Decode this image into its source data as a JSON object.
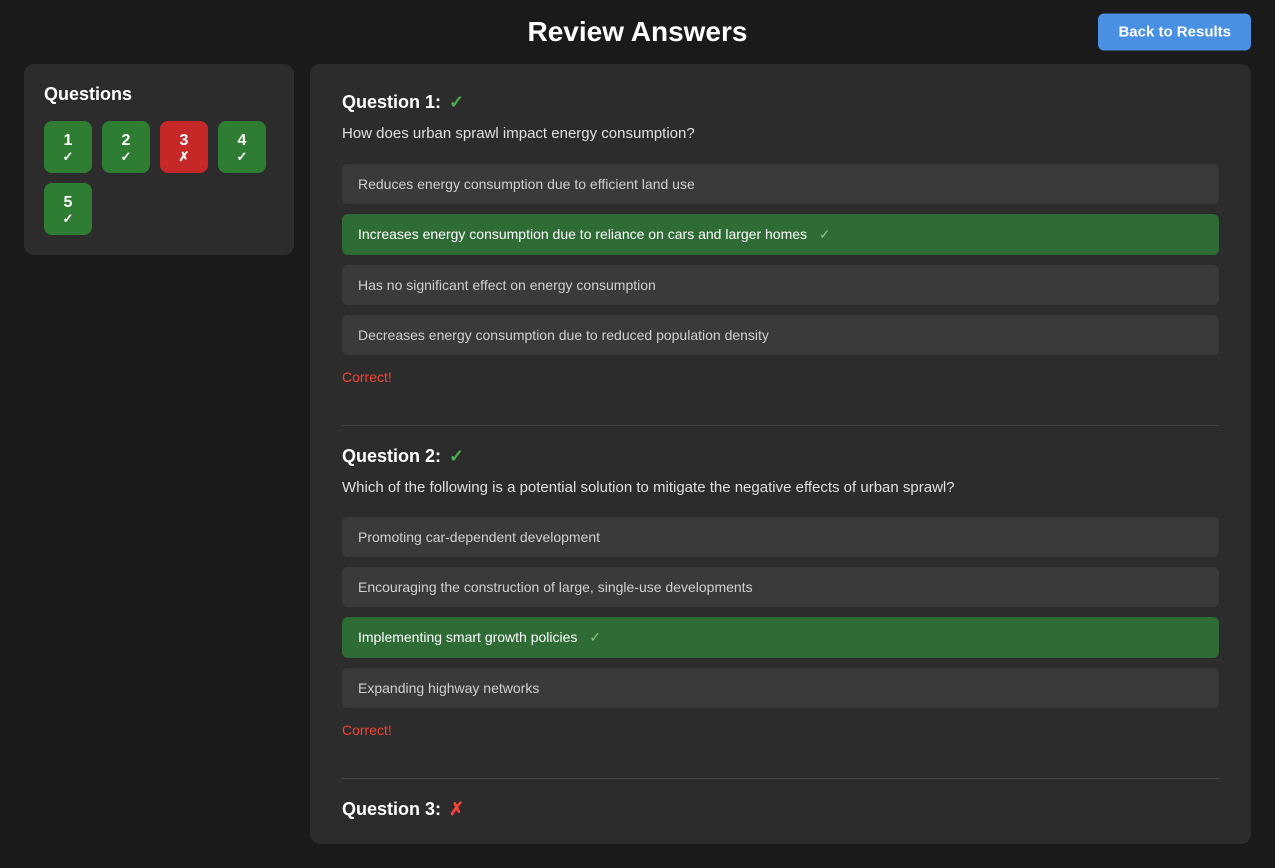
{
  "header": {
    "title": "Review Answers",
    "back_button_label": "Back to Results"
  },
  "sidebar": {
    "title": "Questions",
    "badges": [
      {
        "number": "1",
        "status": "correct",
        "icon": "✓"
      },
      {
        "number": "2",
        "status": "correct",
        "icon": "✓"
      },
      {
        "number": "3",
        "status": "incorrect",
        "icon": "✗"
      },
      {
        "number": "4",
        "status": "correct",
        "icon": "✓"
      },
      {
        "number": "5",
        "status": "correct",
        "icon": "✓"
      }
    ]
  },
  "questions": [
    {
      "id": "q1",
      "label": "Question 1:",
      "status": "correct",
      "status_icon": "✓",
      "text": "How does urban sprawl impact energy consumption?",
      "options": [
        {
          "text": "Reduces energy consumption due to efficient land use",
          "state": "normal"
        },
        {
          "text": "Increases energy consumption due to reliance on cars and larger homes",
          "state": "selected-correct",
          "suffix": "✓"
        },
        {
          "text": "Has no significant effect on energy consumption",
          "state": "normal"
        },
        {
          "text": "Decreases energy consumption due to reduced population density",
          "state": "normal"
        }
      ],
      "result": "Correct!"
    },
    {
      "id": "q2",
      "label": "Question 2:",
      "status": "correct",
      "status_icon": "✓",
      "text": "Which of the following is a potential solution to mitigate the negative effects of urban sprawl?",
      "options": [
        {
          "text": "Promoting car-dependent development",
          "state": "normal"
        },
        {
          "text": "Encouraging the construction of large, single-use developments",
          "state": "normal"
        },
        {
          "text": "Implementing smart growth policies",
          "state": "selected-correct",
          "suffix": "✓"
        },
        {
          "text": "Expanding highway networks",
          "state": "normal"
        }
      ],
      "result": "Correct!"
    },
    {
      "id": "q3",
      "label": "Question 3:",
      "status": "incorrect",
      "status_icon": "✗",
      "text": "",
      "options": [],
      "result": ""
    }
  ],
  "colors": {
    "correct_green": "#4caf50",
    "incorrect_red": "#f44336",
    "selected_correct_bg": "#2e6b35",
    "badge_correct_bg": "#2e7d32",
    "badge_incorrect_bg": "#c62828",
    "back_button_bg": "#4a90e2"
  }
}
